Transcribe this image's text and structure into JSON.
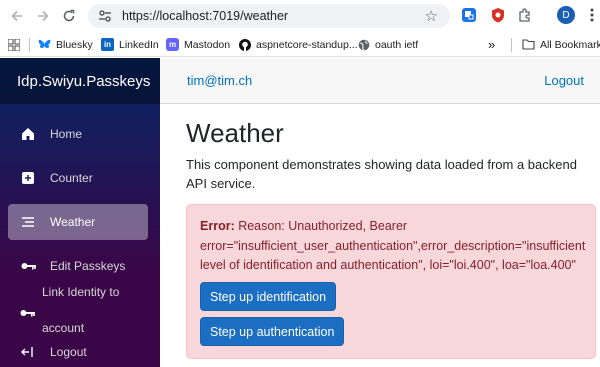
{
  "browser": {
    "url": "https://localhost:7019/weather",
    "profile_initial": "D",
    "bookmarks": [
      "Bluesky",
      "LinkedIn",
      "Mastodon",
      "aspnetcore-standup...",
      "oauth ietf"
    ],
    "bookmarks_overflow": "»",
    "all_bookmarks": "All Bookmarks",
    "icons": [
      "back-arrow-icon",
      "forward-arrow-icon",
      "reload-icon",
      "site-info-icon",
      "star-icon",
      "extension-icon",
      "puzzle-icon",
      "menu-dots-icon",
      "apps-grid-icon",
      "folder-icon"
    ]
  },
  "sidebar": {
    "brand": "Idp.Swiyu.Passkeys",
    "items": [
      {
        "label": "Home",
        "icon": "house-icon"
      },
      {
        "label": "Counter",
        "icon": "plus-square-icon"
      },
      {
        "label": "Weather",
        "icon": "list-icon",
        "active": true
      },
      {
        "label": "Edit Passkeys",
        "icon": "key-icon"
      },
      {
        "label": "Link Identity to",
        "label2": "account",
        "icon": "key-icon"
      },
      {
        "label": "Logout",
        "icon": "logout-arrow-icon"
      }
    ]
  },
  "topbar": {
    "user": "tim@tim.ch",
    "logout": "Logout"
  },
  "main": {
    "title": "Weather",
    "description": "This component demonstrates showing data loaded from a backend API service.",
    "alert": {
      "prefix": "Error:",
      "message": " Reason: Unauthorized, Bearer error=\"insufficient_user_authentication\",error_description=\"insufficient level of identification and authentication\", loi=\"loi.400\", loa=\"loa.400\""
    },
    "buttons": {
      "identification": "Step up identification",
      "authentication": "Step up authentication"
    }
  },
  "colors": {
    "link": "#0071c1",
    "button": "#1b6ec2",
    "alert_bg": "#f8d7da",
    "alert_text": "#842029",
    "sidebar_top": "#052767",
    "sidebar_bottom": "#3a0647"
  }
}
